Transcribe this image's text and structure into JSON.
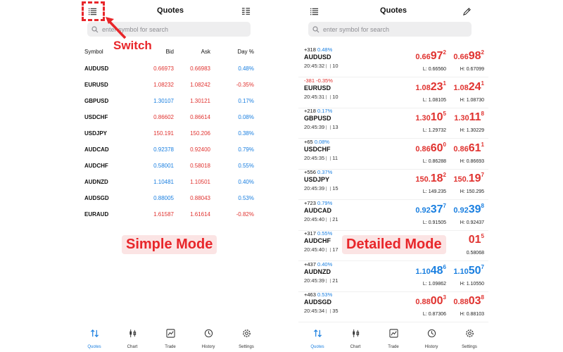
{
  "colors": {
    "red": "#e0322f",
    "blue": "#1a7fe0",
    "annotation": "#e8262a",
    "badge_bg": "#fbe4e4"
  },
  "left": {
    "title": "Quotes",
    "search_placeholder": "enter symbol for search",
    "icons": {
      "left": "list-mode-icon",
      "right": "grid-list-icon"
    },
    "columns": {
      "symbol": "Symbol",
      "bid": "Bid",
      "ask": "Ask",
      "day": "Day %"
    },
    "rows": [
      {
        "symbol": "AUDUSD",
        "bid": "0.66973",
        "ask": "0.66983",
        "change": "0.48%",
        "dir": "pos",
        "bid_color": "red"
      },
      {
        "symbol": "EURUSD",
        "bid": "1.08232",
        "ask": "1.08242",
        "change": "-0.35%",
        "dir": "neg",
        "bid_color": "red"
      },
      {
        "symbol": "GBPUSD",
        "bid": "1.30107",
        "ask": "1.30121",
        "change": "0.17%",
        "dir": "pos",
        "bid_color": "blue"
      },
      {
        "symbol": "USDCHF",
        "bid": "0.86602",
        "ask": "0.86614",
        "change": "0.08%",
        "dir": "pos",
        "bid_color": "red"
      },
      {
        "symbol": "USDJPY",
        "bid": "150.191",
        "ask": "150.206",
        "change": "0.38%",
        "dir": "pos",
        "bid_color": "red"
      },
      {
        "symbol": "AUDCAD",
        "bid": "0.92378",
        "ask": "0.92400",
        "change": "0.79%",
        "dir": "pos",
        "bid_color": "blue"
      },
      {
        "symbol": "AUDCHF",
        "bid": "0.58001",
        "ask": "0.58018",
        "change": "0.55%",
        "dir": "pos",
        "bid_color": "blue"
      },
      {
        "symbol": "AUDNZD",
        "bid": "1.10481",
        "ask": "1.10501",
        "change": "0.40%",
        "dir": "pos",
        "bid_color": "blue"
      },
      {
        "symbol": "AUDSGD",
        "bid": "0.88005",
        "ask": "0.88043",
        "change": "0.53%",
        "dir": "pos",
        "bid_color": "blue"
      },
      {
        "symbol": "EURAUD",
        "bid": "1.61587",
        "ask": "1.61614",
        "change": "-0.82%",
        "dir": "neg",
        "bid_color": "red"
      }
    ]
  },
  "right": {
    "title": "Quotes",
    "search_placeholder": "enter symbol for search",
    "icons": {
      "left": "list-mode-icon",
      "right": "pencil-icon"
    },
    "rows": [
      {
        "points": "+318",
        "pct": "0.48%",
        "symbol": "AUDUSD",
        "time": "20:45:32",
        "spread": "10",
        "color": "red",
        "bid": {
          "pre": "0.66",
          "big": "97",
          "sup": "2"
        },
        "ask": {
          "pre": "0.66",
          "big": "98",
          "sup": "2"
        },
        "low": "L: 0.66560",
        "high": "H: 0.67099"
      },
      {
        "points": "-381",
        "pct": "-0.35%",
        "symbol": "EURUSD",
        "time": "20:45:31",
        "spread": "10",
        "color": "red",
        "bid": {
          "pre": "1.08",
          "big": "23",
          "sup": "1"
        },
        "ask": {
          "pre": "1.08",
          "big": "24",
          "sup": "1"
        },
        "low": "L: 1.08105",
        "high": "H: 1.08730"
      },
      {
        "points": "+218",
        "pct": "0.17%",
        "symbol": "GBPUSD",
        "time": "20:45:39",
        "spread": "13",
        "color": "red",
        "bid": {
          "pre": "1.30",
          "big": "10",
          "sup": "5"
        },
        "ask": {
          "pre": "1.30",
          "big": "11",
          "sup": "8"
        },
        "low": "L: 1.29732",
        "high": "H: 1.30229"
      },
      {
        "points": "+65",
        "pct": "0.08%",
        "symbol": "USDCHF",
        "time": "20:45:35",
        "spread": "11",
        "color": "red",
        "bid": {
          "pre": "0.86",
          "big": "60",
          "sup": "0"
        },
        "ask": {
          "pre": "0.86",
          "big": "61",
          "sup": "1"
        },
        "low": "L: 0.86288",
        "high": "H: 0.86693"
      },
      {
        "points": "+556",
        "pct": "0.37%",
        "symbol": "USDJPY",
        "time": "20:45:39",
        "spread": "15",
        "color": "red",
        "bid": {
          "pre": "150.",
          "big": "18",
          "sup": "2"
        },
        "ask": {
          "pre": "150.",
          "big": "19",
          "sup": "7"
        },
        "low": "L: 149.235",
        "high": "H: 150.295"
      },
      {
        "points": "+723",
        "pct": "0.79%",
        "symbol": "AUDCAD",
        "time": "20:45:40",
        "spread": "21",
        "color": "blue",
        "bid": {
          "pre": "0.92",
          "big": "37",
          "sup": "7"
        },
        "ask": {
          "pre": "0.92",
          "big": "39",
          "sup": "8"
        },
        "low": "L: 0.91505",
        "high": "H: 0.92437"
      },
      {
        "points": "+317",
        "pct": "0.55%",
        "symbol": "AUDCHF",
        "time": "20:45:40",
        "spread": "17",
        "color": "red",
        "bid": {
          "pre": "",
          "big": "",
          "sup": ""
        },
        "ask": {
          "pre": "",
          "big": "01",
          "sup": "5"
        },
        "low": "",
        "high": "0.58068"
      },
      {
        "points": "+437",
        "pct": "0.40%",
        "symbol": "AUDNZD",
        "time": "20:45:39",
        "spread": "21",
        "color": "blue",
        "bid": {
          "pre": "1.10",
          "big": "48",
          "sup": "6"
        },
        "ask": {
          "pre": "1.10",
          "big": "50",
          "sup": "7"
        },
        "low": "L: 1.09862",
        "high": "H: 1.10550"
      },
      {
        "points": "+463",
        "pct": "0.53%",
        "symbol": "AUDSGD",
        "time": "20:45:34",
        "spread": "35",
        "color": "red",
        "bid": {
          "pre": "0.88",
          "big": "00",
          "sup": "3"
        },
        "ask": {
          "pre": "0.88",
          "big": "03",
          "sup": "8"
        },
        "low": "L: 0.87306",
        "high": "H: 0.88103"
      }
    ]
  },
  "tabs": [
    {
      "label": "Quotes",
      "icon": "arrows-updown-icon",
      "active": true
    },
    {
      "label": "Chart",
      "icon": "candlestick-icon",
      "active": false
    },
    {
      "label": "Trade",
      "icon": "trade-chart-icon",
      "active": false
    },
    {
      "label": "History",
      "icon": "clock-history-icon",
      "active": false
    },
    {
      "label": "Settings",
      "icon": "gear-icon",
      "active": false
    }
  ],
  "annotations": {
    "switch": "Switch",
    "simple": "Simple Mode",
    "detailed": "Detailed Mode"
  }
}
